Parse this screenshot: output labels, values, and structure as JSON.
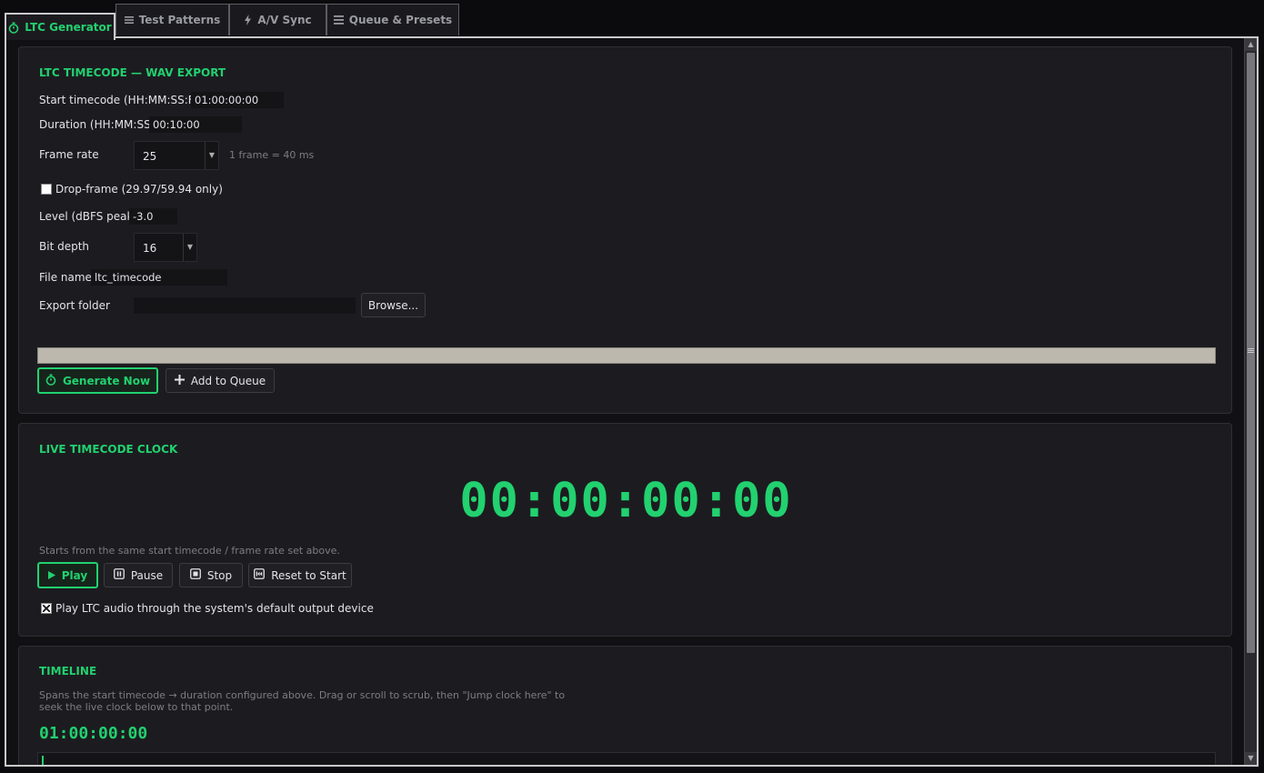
{
  "colors": {
    "accent": "#22d16f",
    "panel": "#1c1c20",
    "background": "#111114"
  },
  "tabs": [
    {
      "label": "LTC Generator",
      "icon": "timer-icon",
      "active": true
    },
    {
      "label": "Test Patterns",
      "icon": "bars-icon",
      "active": false
    },
    {
      "label": "A/V Sync",
      "icon": "lightning-icon",
      "active": false
    },
    {
      "label": "Queue & Presets",
      "icon": "list-icon",
      "active": false
    }
  ],
  "wav_export": {
    "title": "LTC TIMECODE — WAV EXPORT",
    "start_tc_label": "Start timecode (HH:MM:SS:FF)",
    "start_tc_value": "01:00:00:00",
    "duration_label": "Duration (HH:MM:SS)",
    "duration_value": "00:10:00",
    "frame_rate_label": "Frame rate",
    "frame_rate_value": "25",
    "frame_hint": "1 frame = 40 ms",
    "drop_frame_label": "Drop-frame (29.97/59.94 only)",
    "drop_frame_checked": false,
    "level_label": "Level (dBFS peak)",
    "level_value": "-3.0",
    "bit_depth_label": "Bit depth",
    "bit_depth_value": "16",
    "file_name_label": "File name",
    "file_name_value": "ltc_timecode",
    "export_folder_label": "Export folder",
    "export_folder_value": "",
    "browse_label": "Browse...",
    "progress": 0,
    "generate_label": "Generate Now",
    "add_queue_label": "Add to Queue"
  },
  "live_clock": {
    "title": "LIVE TIMECODE CLOCK",
    "timecode": "00:00:00:00",
    "hint": "Starts from the same start timecode / frame rate set above.",
    "play_label": "Play",
    "pause_label": "Pause",
    "stop_label": "Stop",
    "reset_label": "Reset to Start",
    "audio_label": "Play LTC audio through the system's default output device",
    "audio_checked": true
  },
  "timeline": {
    "title": "TIMELINE",
    "hint_line1": "Spans the start timecode → duration configured above. Drag or scroll to scrub, then \"Jump clock here\" to",
    "hint_line2": "seek the live clock below to that point.",
    "timecode": "01:00:00:00",
    "position": 0
  }
}
